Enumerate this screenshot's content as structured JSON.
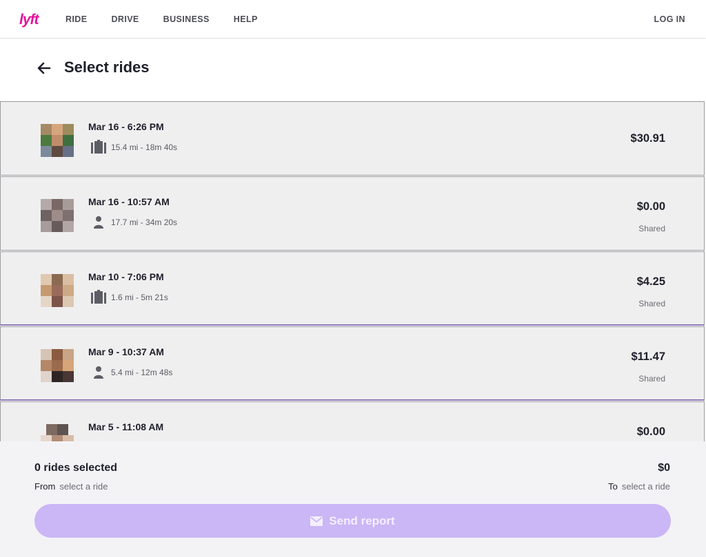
{
  "brand": {
    "logo_text": "lyft",
    "color": "#e3129f"
  },
  "nav": {
    "items": [
      "RIDE",
      "DRIVE",
      "BUSINESS",
      "HELP"
    ],
    "login": "LOG IN"
  },
  "page": {
    "title": "Select rides"
  },
  "rides": [
    {
      "date": "Mar 16 - 6:26 PM",
      "icon": "luggage-icon",
      "meta": "15.4 mi - 18m 40s",
      "price": "$30.91",
      "tag": ""
    },
    {
      "date": "Mar 16 - 10:57 AM",
      "icon": "person-icon",
      "meta": "17.7 mi - 34m 20s",
      "price": "$0.00",
      "tag": "Shared"
    },
    {
      "date": "Mar 10 - 7:06 PM",
      "icon": "luggage-icon",
      "meta": "1.6 mi - 5m 21s",
      "price": "$4.25",
      "tag": "Shared"
    },
    {
      "date": "Mar 9 - 10:37 AM",
      "icon": "person-icon",
      "meta": "5.4 mi - 12m 48s",
      "price": "$11.47",
      "tag": "Shared"
    },
    {
      "date": "Mar 5 - 11:08 AM",
      "icon": "",
      "meta": "",
      "price": "$0.00",
      "tag": ""
    }
  ],
  "footer": {
    "selected": "0 rides selected",
    "total": "$0",
    "from_label": "From",
    "from_value": "select a ride",
    "to_label": "To",
    "to_value": "select a ride",
    "button_icon": "mail-icon",
    "button_label": "Send report",
    "button_color": "#cbb6f6"
  }
}
